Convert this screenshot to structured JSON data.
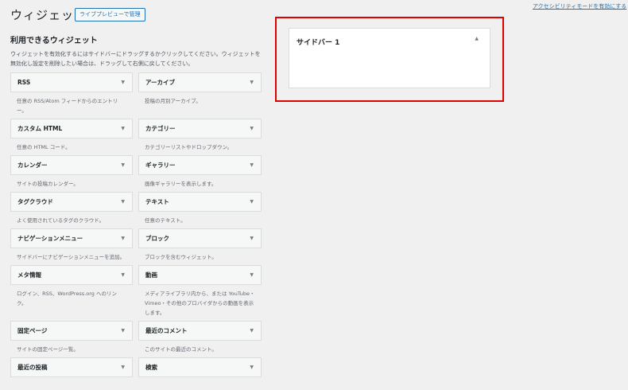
{
  "header": {
    "title": "ウィジェット",
    "live_preview_button": "ライブプレビューで管理",
    "accessibility_link": "アクセシビリティモードを有効にする"
  },
  "available": {
    "heading": "利用できるウィジェット",
    "intro": "ウィジェットを有効化するにはサイドバーにドラッグするかクリックしてください。ウィジェットを無効化し設定を削除したい場合は、ドラッグして右側に戻してください。",
    "widgets": [
      {
        "name": "RSS",
        "desc": "任意の RSS/Atom フィードからのエントリー。"
      },
      {
        "name": "アーカイブ",
        "desc": "投稿の月別アーカイブ。"
      },
      {
        "name": "カスタム HTML",
        "desc": "任意の HTML コード。"
      },
      {
        "name": "カテゴリー",
        "desc": "カテゴリーリストやドロップダウン。"
      },
      {
        "name": "カレンダー",
        "desc": "サイトの投稿カレンダー。"
      },
      {
        "name": "ギャラリー",
        "desc": "画像ギャラリーを表示します。"
      },
      {
        "name": "タグクラウド",
        "desc": "よく使用されているタグのクラウド。"
      },
      {
        "name": "テキスト",
        "desc": "任意のテキスト。"
      },
      {
        "name": "ナビゲーションメニュー",
        "desc": "サイドバーにナビゲーションメニューを追加。"
      },
      {
        "name": "ブロック",
        "desc": "ブロックを含むウィジェット。"
      },
      {
        "name": "メタ情報",
        "desc": "ログイン、RSS、WordPress.org へのリンク。"
      },
      {
        "name": "動画",
        "desc": "メディアライブラリ内から、または YouTube・Vimeo・その他のプロバイダからの動画を表示します。"
      },
      {
        "name": "固定ページ",
        "desc": "サイトの固定ページ一覧。"
      },
      {
        "name": "最近のコメント",
        "desc": "このサイトの最近のコメント。"
      },
      {
        "name": "最近の投稿",
        "desc": ""
      },
      {
        "name": "検索",
        "desc": ""
      }
    ]
  },
  "sidebar": {
    "title": "サイドバー 1"
  },
  "icons": {
    "expand": "▼",
    "collapse": "▲"
  },
  "colors": {
    "highlight": "#e00000",
    "link": "#2271b1"
  }
}
